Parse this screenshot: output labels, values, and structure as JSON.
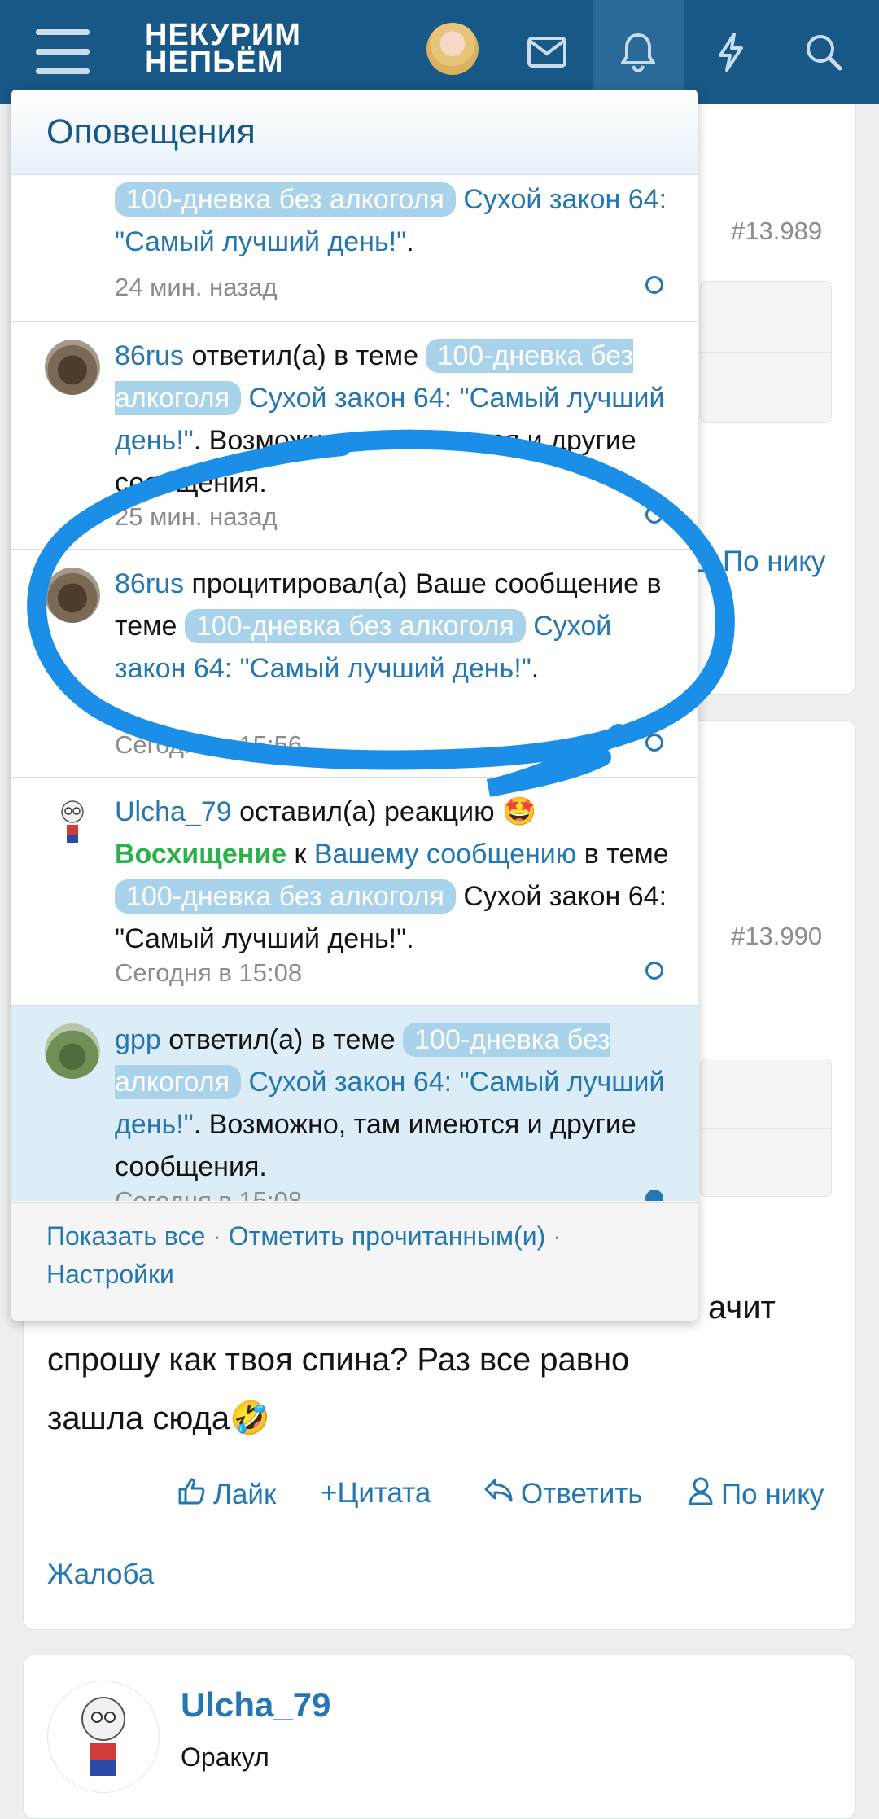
{
  "header": {
    "logo_line1": "НЕКУРИМ",
    "logo_line2": "НЕПЬЁМ",
    "accent": "#185886"
  },
  "background": {
    "post1_number": "#13.989",
    "post2_number": "#13.990",
    "by_nick_top": "По нику",
    "post_text_line1": "ачит",
    "post_text_line2": "спрошу как твоя спина? Раз все равно",
    "post_text_line3": "зашла сюда🤣",
    "actions": {
      "like": "Лайк",
      "quote": "+Цитата",
      "reply": "Ответить",
      "by_nick": "По нику"
    },
    "report": "Жалоба",
    "next_user": "Ulcha_79",
    "next_user_title": "Оракул"
  },
  "dropdown": {
    "title": "Оповещения",
    "notifications": [
      {
        "tag": "100-дневка без алкоголя",
        "thread": "Сухой закон 64: \"Самый лучший день!\"",
        "tail": ".",
        "time": "24 мин. назад",
        "unread": false
      },
      {
        "user": "86rus",
        "action": "ответил(а) в теме",
        "tag": "100-дневка без алкоголя",
        "thread": "Сухой закон 64: \"Самый лучший день!\"",
        "tail": ". Возможно, там имеются и другие сообщения.",
        "time": "25 мин. назад",
        "unread": false
      },
      {
        "user": "86rus",
        "action": "процитировал(а) Ваше сообщение в теме",
        "tag": "100-дневка без алкоголя",
        "thread": "Сухой закон 64: \"Самый лучший день!\"",
        "tail": ".",
        "time": "Сегодня в 15:56",
        "unread": false
      },
      {
        "user": "Ulcha_79",
        "action": "оставил(а) реакцию",
        "emoji": "🤩",
        "reaction": "Восхищение",
        "to": "к",
        "your_post": "Вашему сообщению",
        "in_thread": "в теме",
        "tag": "100-дневка без алкоголя",
        "thread": "Сухой закон 64: \"Самый лучший день!\"",
        "tail": ".",
        "time": "Сегодня в 15:08",
        "unread": false
      },
      {
        "user": "gpp",
        "action": "ответил(а) в теме",
        "tag": "100-дневка без алкоголя",
        "thread": "Сухой закон 64: \"Самый лучший день!\"",
        "tail": ". Возможно, там имеются и другие сообщения.",
        "time": "Сегодня в 15:08",
        "unread": true
      }
    ],
    "footer": {
      "show_all": "Показать все",
      "mark_read": "Отметить прочитанным(и)",
      "settings": "Настройки",
      "separator": "·"
    }
  }
}
